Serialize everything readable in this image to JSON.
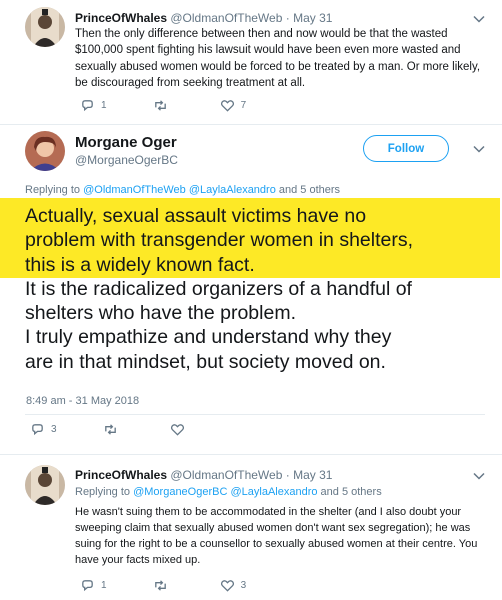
{
  "tweet1": {
    "name": "PrinceOfWhales",
    "handle": "@OldmanOfTheWeb",
    "dot": "·",
    "date": "May 31",
    "text": "Then the only difference between then and now would be that the wasted $100,000 spent fighting his lawsuit would have been even more wasted and sexually abused women would be forced to be treated by a man. Or more likely, be discouraged from seeking treatment at all.",
    "reply_count": "1",
    "retweet_count": "",
    "like_count": "7"
  },
  "main_tweet": {
    "name": "Morgane Oger",
    "handle": "@MorganeOgerBC",
    "follow_label": "Follow",
    "reply_prefix": "Replying to ",
    "reply_user1": "@OldmanOfTheWeb",
    "reply_user2": "@LaylaAlexandro",
    "reply_suffix": " and 5 others",
    "line1": "Actually, sexual assault victims have no",
    "line2": "problem with transgender women in shelters,",
    "line3": "this is a widely known fact.",
    "line4": "It is the radicalized organizers of a handful of",
    "line5": "shelters who have the problem.",
    "line6": "I truly empathize and understand why they",
    "line7": "are in that mindset, but society moved on.",
    "timestamp": "8:49 am - 31 May 2018",
    "reply_count": "3",
    "retweet_count": "",
    "like_count": ""
  },
  "tweet3": {
    "name": "PrinceOfWhales",
    "handle": "@OldmanOfTheWeb",
    "dot": "·",
    "date": "May 31",
    "reply_prefix": "Replying to ",
    "reply_user1": "@MorganeOgerBC",
    "reply_user2": "@LaylaAlexandro",
    "reply_suffix": " and 5 others",
    "text": "He wasn't suing them to be accommodated in the shelter (and I also doubt your sweeping claim that sexually abused women don't want sex segregation); he was suing for the right to be a counsellor to sexually abused women at their centre. You  have your facts mixed up.",
    "reply_count": "1",
    "retweet_count": "",
    "like_count": "3"
  },
  "colors": {
    "accent": "#1da1f2",
    "highlight": "#fde926",
    "muted": "#657786"
  },
  "icons": [
    "reply-icon",
    "retweet-icon",
    "like-icon",
    "chevron-down-icon",
    "avatar"
  ]
}
